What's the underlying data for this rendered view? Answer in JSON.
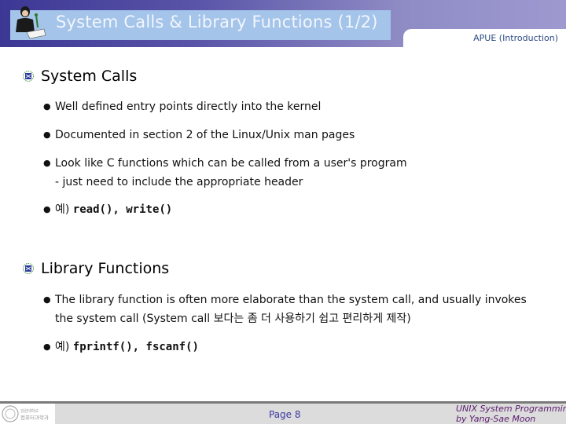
{
  "header": {
    "title": "System Calls & Library Functions (1/2)",
    "tab_label": "APUE (Introduction)",
    "logo_icon": "person-writing-icon"
  },
  "sections": [
    {
      "heading": "System Calls",
      "icon": "section-marker-icon",
      "bullets": [
        {
          "text": "Well defined entry points directly into the kernel"
        },
        {
          "text": "Documented in section 2 of the Linux/Unix man pages"
        },
        {
          "text": "Look like C functions which can be called from a user's program",
          "continuation": "- just need to include the appropriate header"
        },
        {
          "prefix": "예) ",
          "code": "read(), write()"
        }
      ]
    },
    {
      "heading": "Library Functions",
      "icon": "section-marker-icon",
      "bullets": [
        {
          "text": "The library function is often more elaborate than the system call, and usually invokes",
          "continuation": "the system call (System call 보다는 좀 더 사용하기 쉽고 편리하게 제작)"
        },
        {
          "prefix": "예) ",
          "code": "fprintf(), fscanf()"
        }
      ]
    }
  ],
  "footer": {
    "page_label": "Page 8",
    "credit_line1": "UNIX System Programming",
    "credit_line2": "by Yang-Sae Moon",
    "logo_text": "강원대학교 컴퓨터과학과"
  },
  "colors": {
    "header_dark": "#3c3794",
    "header_light": "#9e9ad0",
    "title_box": "#a4c4ea",
    "tab_text": "#2c4a86",
    "page_num": "#3a36a0",
    "credit": "#5a1a6e"
  }
}
